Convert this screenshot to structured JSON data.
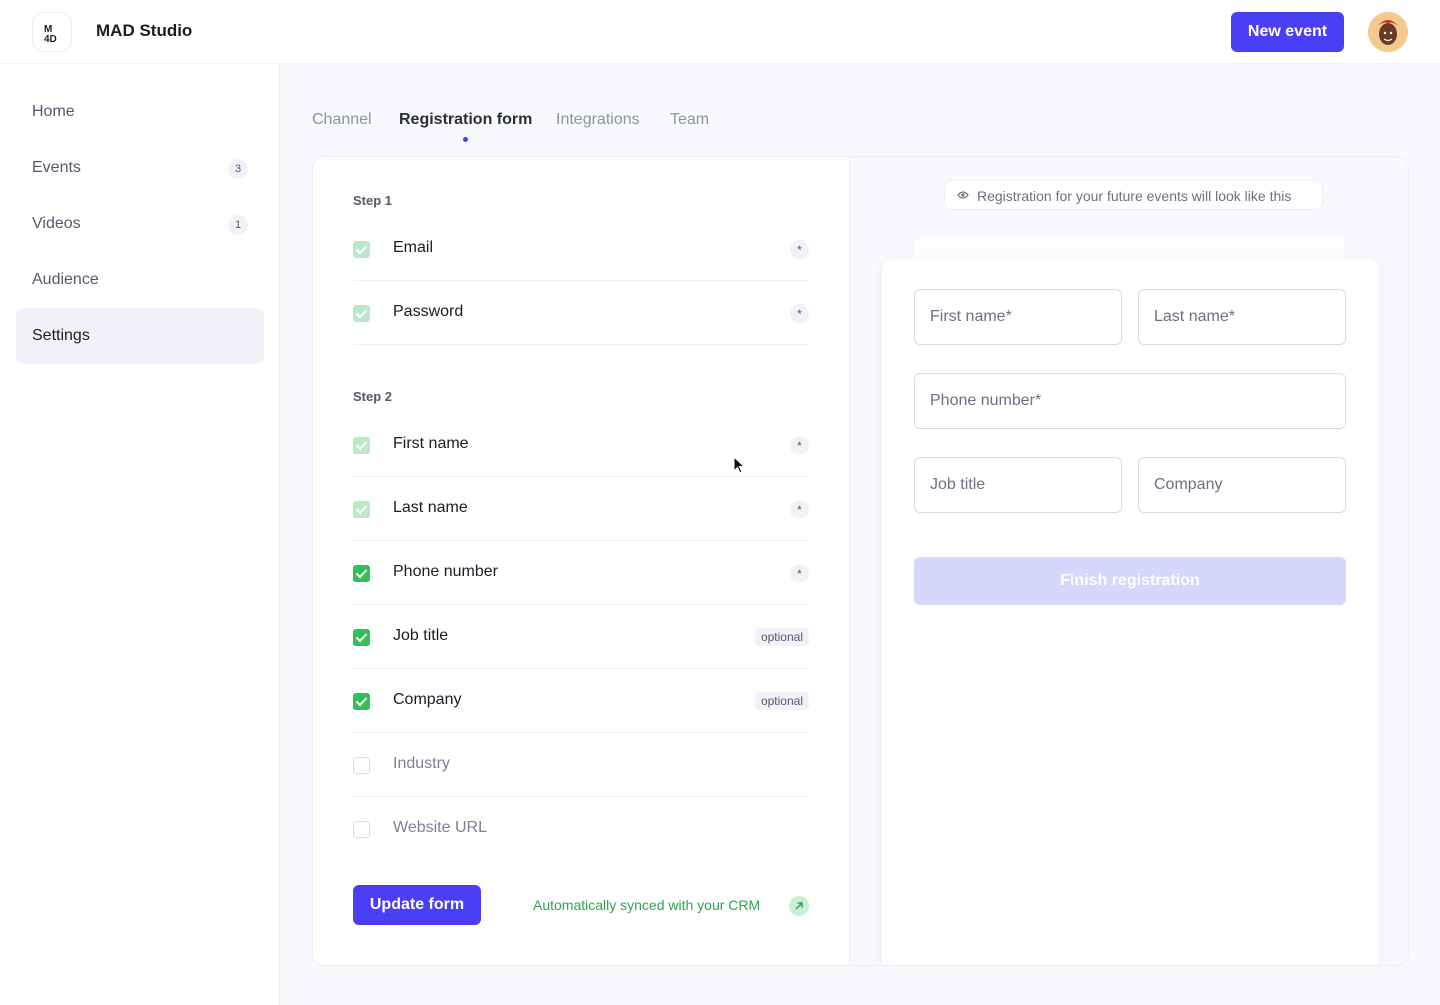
{
  "app": {
    "title": "MAD Studio",
    "logo_icon": "mad-logo-icon"
  },
  "header": {
    "new_event_label": "New event",
    "accent": "#4b3ff6"
  },
  "sidebar": {
    "items": [
      {
        "label": "Home",
        "badge": null
      },
      {
        "label": "Events",
        "badge": "3"
      },
      {
        "label": "Videos",
        "badge": "1"
      },
      {
        "label": "Audience",
        "badge": null
      },
      {
        "label": "Settings",
        "badge": null,
        "active": true
      }
    ]
  },
  "tabs": [
    {
      "label": "Channel"
    },
    {
      "label": "Registration form",
      "active": true
    },
    {
      "label": "Integrations"
    },
    {
      "label": "Team"
    }
  ],
  "form_builder": {
    "step1_label": "Step 1",
    "step2_label": "Step 2",
    "required_mark": "*",
    "optional_label": "optional",
    "step1_fields": [
      {
        "label": "Email",
        "state": "locked",
        "tag": "required"
      },
      {
        "label": "Password",
        "state": "locked",
        "tag": "required"
      }
    ],
    "step2_fields": [
      {
        "label": "First name",
        "state": "locked",
        "tag": "required"
      },
      {
        "label": "Last name",
        "state": "locked",
        "tag": "required"
      },
      {
        "label": "Phone number",
        "state": "checked",
        "tag": "required"
      },
      {
        "label": "Job title",
        "state": "checked",
        "tag": "optional"
      },
      {
        "label": "Company",
        "state": "checked",
        "tag": "optional"
      },
      {
        "label": "Industry",
        "state": "unchecked",
        "tag": null
      },
      {
        "label": "Website URL",
        "state": "unchecked",
        "tag": null
      }
    ],
    "update_label": "Update form",
    "crm_text": "Automatically synced with your CRM",
    "status_color": "#2fbf5b"
  },
  "preview": {
    "note": "Registration for your future events will look like this",
    "first_name_placeholder": "First name*",
    "last_name_placeholder": "Last name*",
    "phone_placeholder": "Phone number*",
    "job_title_placeholder": "Job title",
    "company_placeholder": "Company",
    "finish_label": "Finish registration"
  }
}
